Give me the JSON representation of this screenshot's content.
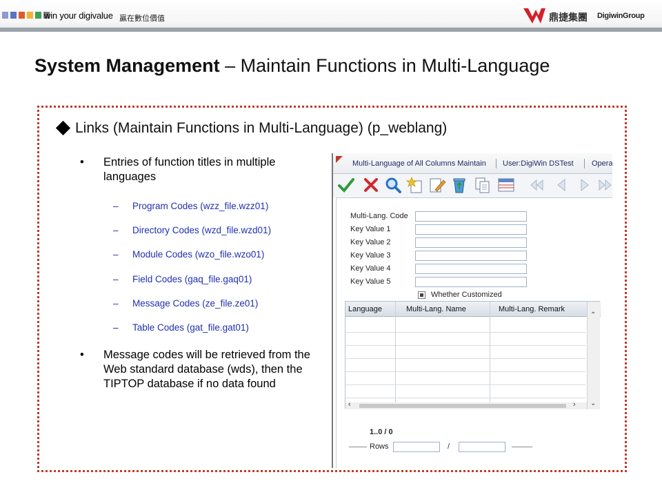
{
  "header": {
    "slogan": "win your digivalue",
    "slogan_cn": "贏在數位價值",
    "logo_cn": "鼎捷集團",
    "logo_en": "DigiwinGroup",
    "square_colors": [
      "#8a9bd0",
      "#5b74c2",
      "#e05a2b",
      "#f2b233",
      "#3f9f5a",
      "#7d7d7d"
    ]
  },
  "title": {
    "bold_part": "System Management",
    "rest": " – Maintain Functions in Multi-Language"
  },
  "heading": "Links (Maintain Functions in Multi-Language) (p_weblang)",
  "bullets": [
    {
      "dot": "•",
      "text": "Entries of function titles in multiple languages"
    },
    {
      "dot": "•",
      "text": "Message codes will be retrieved from the Web standard database (wds), then the TIPTOP database if no data found"
    }
  ],
  "sub_items": [
    {
      "dash": "–",
      "text": "Program Codes (wzz_file.wzz01)"
    },
    {
      "dash": "–",
      "text": "Directory Codes (wzd_file.wzd01)"
    },
    {
      "dash": "–",
      "text": "Module Codes (wzo_file.wzo01)"
    },
    {
      "dash": "–",
      "text": "Field Codes (gaq_file.gaq01)"
    },
    {
      "dash": "–",
      "text": "Message Codes (ze_file.ze01)"
    },
    {
      "dash": "–",
      "text": "Table Codes (gat_file.gat01)"
    }
  ],
  "app": {
    "tab_title": "Multi-Language of All Columns Maintain",
    "tab_user": "User:DigiWin DSTest",
    "tab_extra": "Operat",
    "toolbar_icons": [
      "confirm-check-icon",
      "cancel-x-icon",
      "query-magnifier-icon",
      "new-star-icon",
      "edit-pencil-icon",
      "recycle-bin-icon",
      "copy-pages-icon",
      "layout-grid-icon",
      "first-record-icon",
      "previous-record-icon",
      "next-record-icon",
      "last-record-icon"
    ],
    "fields": [
      {
        "label": "Multi-Lang. Code",
        "value": ""
      },
      {
        "label": "Key Value 1",
        "value": ""
      },
      {
        "label": "Key Value 2",
        "value": ""
      },
      {
        "label": "Key Value 3",
        "value": ""
      },
      {
        "label": "Key Value 4",
        "value": ""
      },
      {
        "label": "Key Value 5",
        "value": ""
      }
    ],
    "checkbox_label": "Whether Customized",
    "grid": {
      "columns": [
        "Language",
        "Multi-Lang. Name",
        "Multi-Lang. Remark"
      ],
      "rows": []
    },
    "counter": "1..0 / 0",
    "rows_label": "Rows",
    "rows_slash": "/",
    "rows_from": "",
    "rows_to": ""
  }
}
